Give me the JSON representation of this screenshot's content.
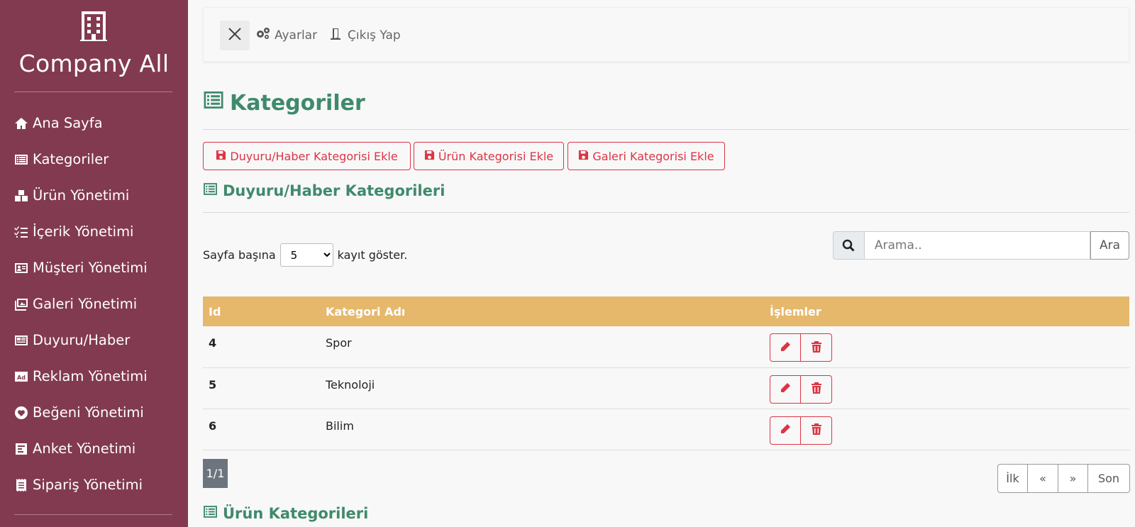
{
  "brand": {
    "title": "Company All",
    "icon": "building-icon"
  },
  "sidebar": {
    "items": [
      {
        "label": "Ana Sayfa",
        "icon": "home-icon"
      },
      {
        "label": "Kategoriler",
        "icon": "list-icon"
      },
      {
        "label": "Ürün Yönetimi",
        "icon": "boxes-icon"
      },
      {
        "label": "İçerik Yönetimi",
        "icon": "tasks-icon"
      },
      {
        "label": "Müşteri Yönetimi",
        "icon": "id-card-icon"
      },
      {
        "label": "Galeri Yönetimi",
        "icon": "images-icon"
      },
      {
        "label": "Duyuru/Haber",
        "icon": "newspaper-icon"
      },
      {
        "label": "Reklam Yönetimi",
        "icon": "ad-icon"
      },
      {
        "label": "Beğeni Yönetimi",
        "icon": "heart-icon"
      },
      {
        "label": "Anket Yönetimi",
        "icon": "poll-icon"
      },
      {
        "label": "Sipariş Yönetimi",
        "icon": "receipt-icon"
      }
    ]
  },
  "topbar": {
    "settings_label": "Ayarlar",
    "logout_label": "Çıkış Yap"
  },
  "page": {
    "title": "Kategoriler"
  },
  "actions": {
    "add_news_category": "Duyuru/Haber Kategorisi Ekle",
    "add_product_category": "Ürün Kategorisi Ekle",
    "add_gallery_category": "Galeri Kategorisi Ekle"
  },
  "news_section": {
    "title": "Duyuru/Haber Kategorileri"
  },
  "per_page": {
    "prefix": "Sayfa başına",
    "selected": "5",
    "suffix": "kayıt göster."
  },
  "search": {
    "placeholder": "Arama..",
    "button_label": "Ara"
  },
  "table": {
    "columns": [
      "Id",
      "Kategori Adı",
      "İşlemler"
    ],
    "rows": [
      {
        "id": "4",
        "name": "Spor"
      },
      {
        "id": "5",
        "name": "Teknoloji"
      },
      {
        "id": "6",
        "name": "Bilim"
      }
    ]
  },
  "pagination": {
    "indicator": "1/1",
    "first": "İlk",
    "prev": "«",
    "next": "»",
    "last": "Son"
  },
  "product_section": {
    "title": "Ürün Kategorileri"
  },
  "colors": {
    "sidebar": "#823a51",
    "accent_green": "#3f8a6c",
    "danger": "#dc3545",
    "table_header": "#e6b86c",
    "page_indicator": "#6c757d"
  }
}
